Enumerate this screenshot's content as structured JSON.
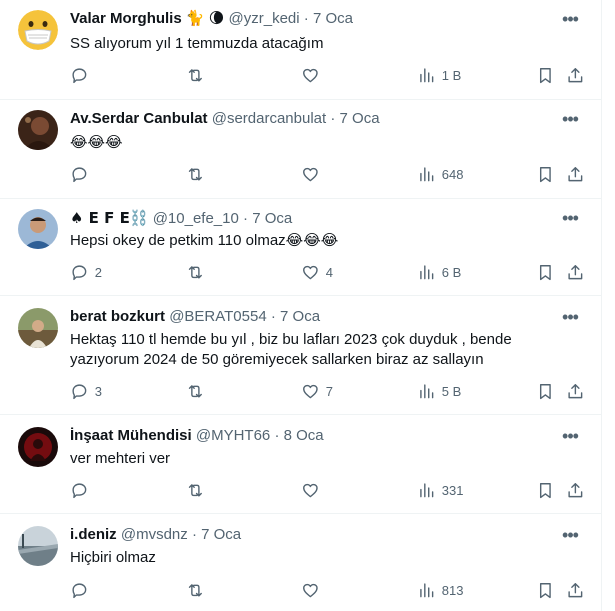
{
  "tweets": [
    {
      "name": "Valar Morghulis 🐈 🌘",
      "handle": "@yzr_kedi",
      "dot": "·",
      "date": "7 Oca",
      "text": "SS alıyorum yıl 1 temmuzda atacağım",
      "replies": "",
      "retweets": "",
      "likes": "",
      "views": "1 B",
      "avatar_color": "#e9b84a"
    },
    {
      "name": "Av.Serdar Canbulat",
      "handle": "@serdarcanbulat",
      "dot": "·",
      "date": "7 Oca",
      "text": "😂😂😂",
      "replies": "",
      "retweets": "",
      "likes": "",
      "views": "648",
      "avatar_color": "#5a3a2b"
    },
    {
      "name": "♠ E F E⛓️",
      "handle": "@10_efe_10",
      "dot": "·",
      "date": "7 Oca",
      "text": "Hepsi okey de petkim 110 olmaz😂😂😂",
      "replies": "2",
      "retweets": "",
      "likes": "4",
      "views": "6 B",
      "avatar_color": "#3f6fa6"
    },
    {
      "name": "berat bozkurt",
      "handle": "@BERAT0554",
      "dot": "·",
      "date": "7 Oca",
      "text": "Hektaş 110 tl hemde bu yıl , biz bu lafları 2023 çok duyduk , bende yazıyorum 2024 de 50 göremiyecek sallarken biraz az sallayın",
      "replies": "3",
      "retweets": "",
      "likes": "7",
      "views": "5 B",
      "avatar_color": "#6b7a4a"
    },
    {
      "name": "İnşaat Mühendisi",
      "handle": "@MYHT66",
      "dot": "·",
      "date": "8 Oca",
      "text": "ver mehteri ver",
      "replies": "",
      "retweets": "",
      "likes": "",
      "views": "331",
      "avatar_color": "#8b0d12"
    },
    {
      "name": "i.deniz",
      "handle": "@mvsdnz",
      "dot": "·",
      "date": "7 Oca",
      "text": "Hiçbiri olmaz",
      "replies": "",
      "retweets": "",
      "likes": "",
      "views": "813",
      "avatar_color": "#8a9aa6"
    }
  ],
  "colors": {
    "text": "#0f1419",
    "secondary": "#536471",
    "divider": "#eff3f4"
  },
  "icons": [
    "reply-icon",
    "retweet-icon",
    "like-icon",
    "views-icon",
    "bookmark-icon",
    "share-icon",
    "more-icon"
  ]
}
